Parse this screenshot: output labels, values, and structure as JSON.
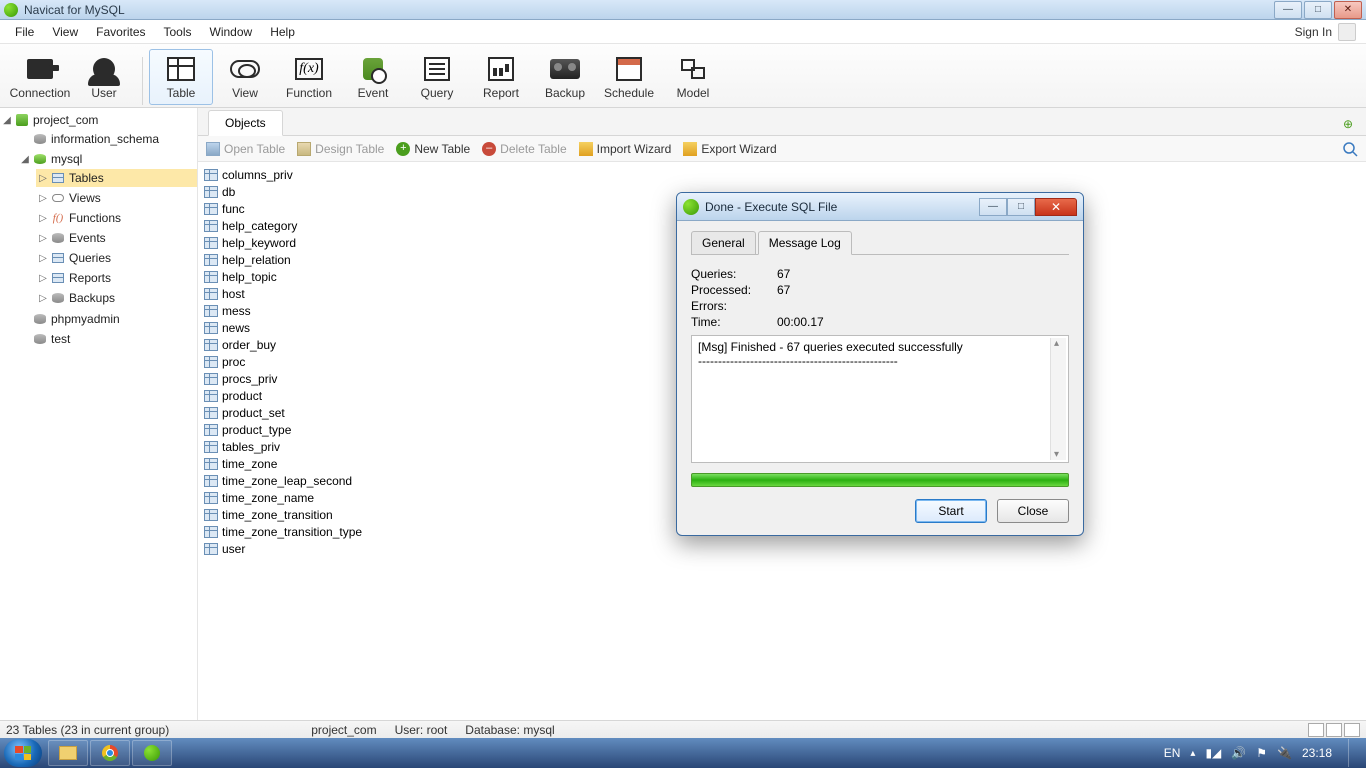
{
  "window": {
    "title": "Navicat for MySQL"
  },
  "menubar": {
    "items": [
      "File",
      "View",
      "Favorites",
      "Tools",
      "Window",
      "Help"
    ],
    "signin": "Sign In"
  },
  "toolbar": {
    "buttons": [
      {
        "label": "Connection",
        "icon": "ic-conn"
      },
      {
        "label": "User",
        "icon": "ic-user"
      },
      {
        "label": "Table",
        "icon": "ic-table",
        "selected": true
      },
      {
        "label": "View",
        "icon": "ic-view"
      },
      {
        "label": "Function",
        "icon": "ic-func"
      },
      {
        "label": "Event",
        "icon": "ic-event"
      },
      {
        "label": "Query",
        "icon": "ic-query"
      },
      {
        "label": "Report",
        "icon": "ic-report"
      },
      {
        "label": "Backup",
        "icon": "ic-backup"
      },
      {
        "label": "Schedule",
        "icon": "ic-sched"
      },
      {
        "label": "Model",
        "icon": "ic-model"
      }
    ]
  },
  "tree": {
    "connection": "project_com",
    "databases": {
      "info": "information_schema",
      "mysql": "mysql",
      "phpmyadmin": "phpmyadmin",
      "test": "test"
    },
    "mysql_children": [
      "Tables",
      "Views",
      "Functions",
      "Events",
      "Queries",
      "Reports",
      "Backups"
    ]
  },
  "objects_tab": "Objects",
  "subtoolbar": {
    "open": "Open Table",
    "design": "Design Table",
    "new": "New Table",
    "delete": "Delete Table",
    "import": "Import Wizard",
    "export": "Export Wizard"
  },
  "tables": [
    "columns_priv",
    "db",
    "func",
    "help_category",
    "help_keyword",
    "help_relation",
    "help_topic",
    "host",
    "mess",
    "news",
    "order_buy",
    "proc",
    "procs_priv",
    "product",
    "product_set",
    "product_type",
    "tables_priv",
    "time_zone",
    "time_zone_leap_second",
    "time_zone_name",
    "time_zone_transition",
    "time_zone_transition_type",
    "user"
  ],
  "dialog": {
    "title": "Done - Execute SQL File",
    "tabs": {
      "general": "General",
      "msglog": "Message Log"
    },
    "stats": {
      "queries_label": "Queries:",
      "queries": "67",
      "processed_label": "Processed:",
      "processed": "67",
      "errors_label": "Errors:",
      "errors": "",
      "time_label": "Time:",
      "time": "00:00.17"
    },
    "msg1": "[Msg] Finished - 67 queries executed successfully",
    "msg2": "--------------------------------------------------",
    "start": "Start",
    "close": "Close"
  },
  "status": {
    "left": "23 Tables (23 in current group)",
    "conn": "project_com",
    "user": "User: root",
    "db": "Database: mysql"
  },
  "taskbar": {
    "lang": "EN",
    "time": "23:18"
  }
}
